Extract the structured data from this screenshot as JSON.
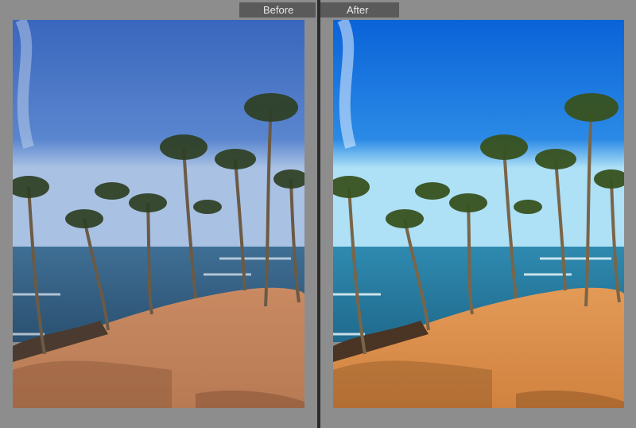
{
  "comparison": {
    "before_label": "Before",
    "after_label": "After"
  },
  "colors": {
    "frame": "#8d8d8d",
    "divider": "#2b2b2b",
    "label_bg": "#5a5a5a",
    "label_text": "#e9e9e9",
    "before_sky": "#3f6fc2",
    "after_sky": "#1172e0",
    "before_sand": "#c9835a",
    "after_sand": "#e0904e"
  },
  "images": {
    "before": {
      "description_icon": "photo-before-icon"
    },
    "after": {
      "description_icon": "photo-after-icon"
    }
  }
}
